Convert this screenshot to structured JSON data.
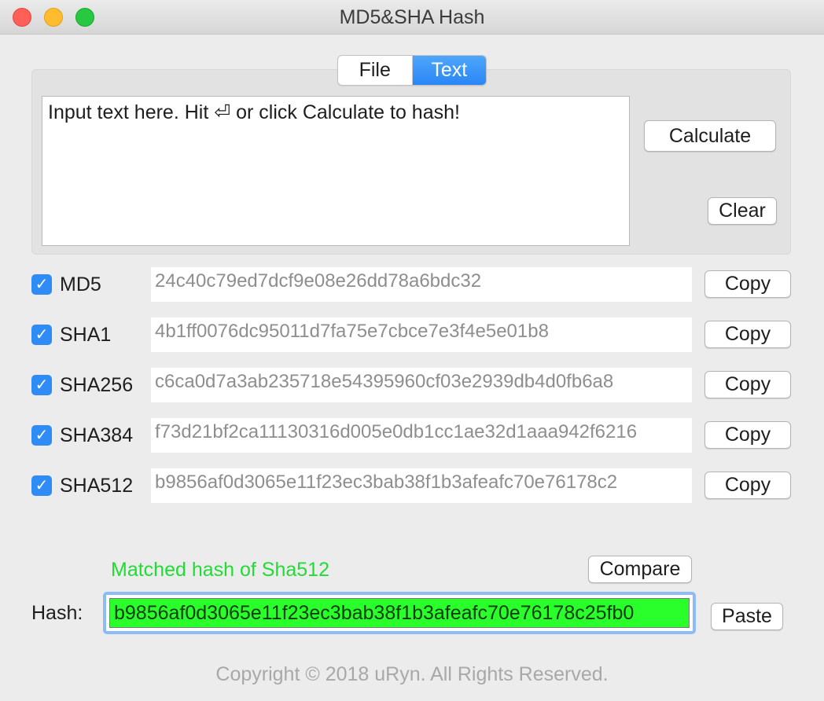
{
  "window": {
    "title": "MD5&SHA Hash"
  },
  "tabs": [
    {
      "label": "File",
      "active": false
    },
    {
      "label": "Text",
      "active": true
    }
  ],
  "input": {
    "text": "Input text here. Hit ⏎ or click Calculate to hash!"
  },
  "buttons": {
    "calculate": "Calculate",
    "clear": "Clear",
    "copy": "Copy",
    "compare": "Compare",
    "paste": "Paste"
  },
  "hashes": [
    {
      "algo": "MD5",
      "checked": true,
      "value": "24c40c79ed7dcf9e08e26dd78a6bdc32"
    },
    {
      "algo": "SHA1",
      "checked": true,
      "value": "4b1ff0076dc95011d7fa75e7cbce7e3f4e5e01b8"
    },
    {
      "algo": "SHA256",
      "checked": true,
      "value": "c6ca0d7a3ab235718e54395960cf03e2939db4d0fb6a8"
    },
    {
      "algo": "SHA384",
      "checked": true,
      "value": "f73d21bf2ca11130316d005e0db1cc1ae32d1aaa942f6216"
    },
    {
      "algo": "SHA512",
      "checked": true,
      "value": "b9856af0d3065e11f23ec3bab38f1b3afeafc70e76178c2"
    }
  ],
  "compare": {
    "status": "Matched hash of Sha512",
    "status_color": "#21dc35",
    "hash_label": "Hash:",
    "hash_value": "b9856af0d3065e11f23ec3bab38f1b3afeafc70e76178c25fb0"
  },
  "footer": {
    "copyright": "Copyright © 2018 uRyn. All Rights Reserved."
  },
  "colors": {
    "accent": "#2f8cf6",
    "match_field": "#2bff2b"
  }
}
